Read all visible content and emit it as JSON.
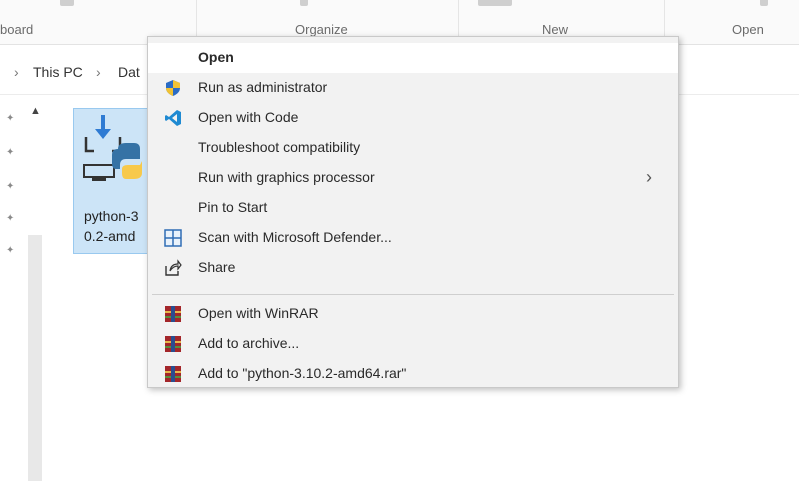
{
  "ribbon": {
    "groups": [
      "board",
      "Organize",
      "New",
      "Open"
    ]
  },
  "breadcrumb": {
    "chevron": "›",
    "this_pc": "This PC",
    "data": "Dat"
  },
  "file": {
    "name_line1": "python-3",
    "name_line2": "0.2-amd"
  },
  "context_menu": {
    "items": [
      {
        "label": "Open",
        "icon": "none",
        "bold": true
      },
      {
        "label": "Run as administrator",
        "icon": "uac-shield-icon"
      },
      {
        "label": "Open with Code",
        "icon": "vscode-icon"
      },
      {
        "label": "Troubleshoot compatibility",
        "icon": "none"
      },
      {
        "label": "Run with graphics processor",
        "icon": "none",
        "submenu": true
      },
      {
        "label": "Pin to Start",
        "icon": "none"
      },
      {
        "label": "Scan with Microsoft Defender...",
        "icon": "defender-icon"
      },
      {
        "label": "Share",
        "icon": "share-icon"
      },
      {
        "label": "Open with WinRAR",
        "icon": "winrar-icon"
      },
      {
        "label": "Add to archive...",
        "icon": "winrar-icon"
      },
      {
        "label": "Add to \"python-3.10.2-amd64.rar\"",
        "icon": "winrar-icon"
      }
    ],
    "submenu_arrow": "›"
  },
  "colors": {
    "selection_bg": "#cce4f7",
    "selection_border": "#99c9ef",
    "menu_bg": "#f2f2f2",
    "vscode_blue": "#1f8ad2",
    "shield_blue": "#2b6cc4",
    "shield_yellow": "#f1c232",
    "winrar_red": "#a3262a"
  }
}
